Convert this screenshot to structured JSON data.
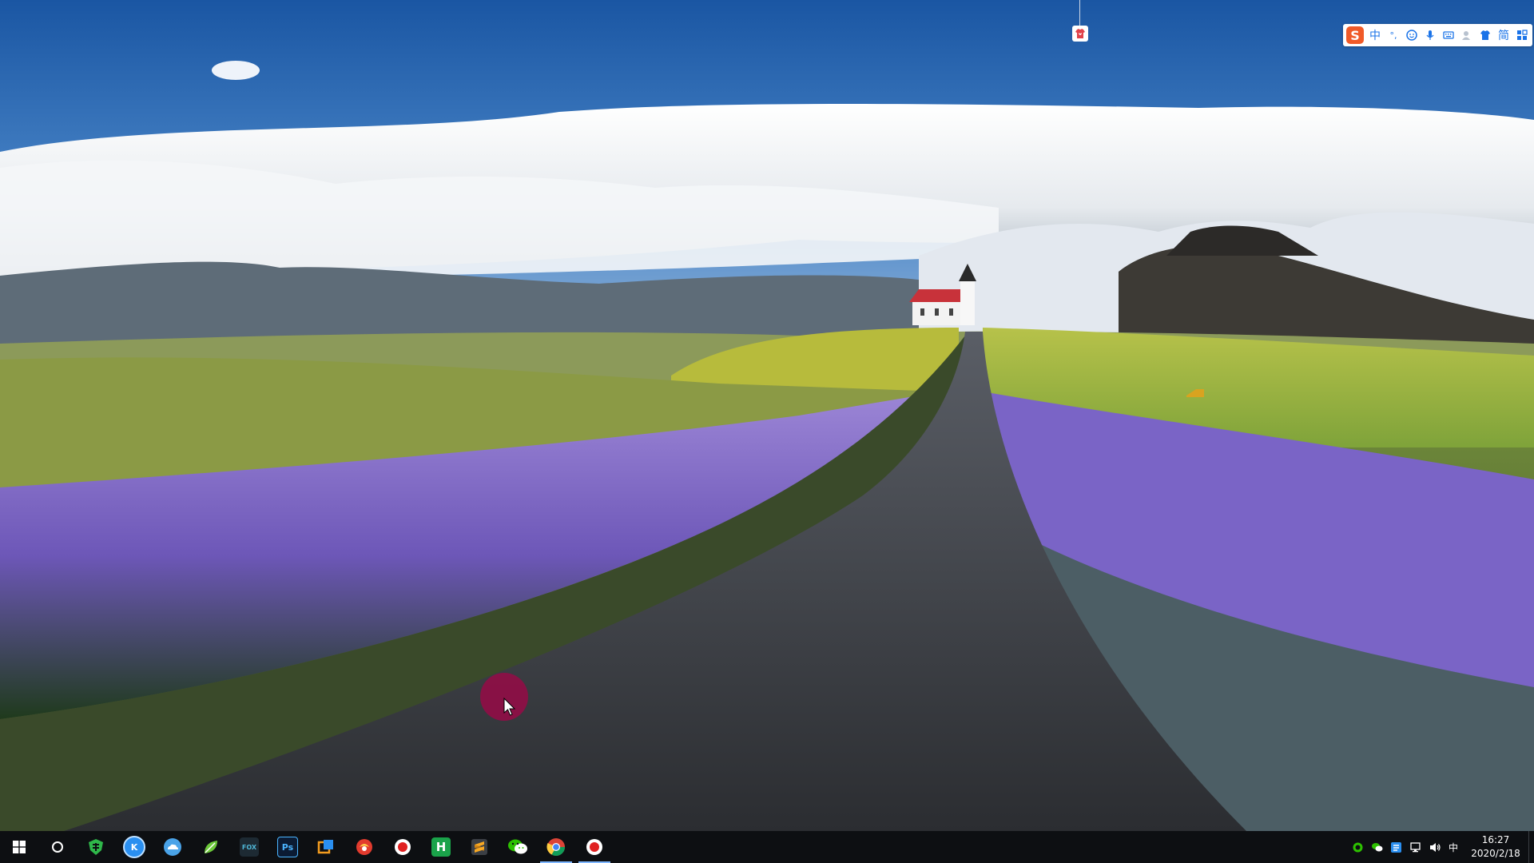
{
  "ime": {
    "icon": "sogou-logo",
    "mode_label": "中",
    "punctuation_label": "°,",
    "simplified_label": "简",
    "buttons": [
      "emoji-icon",
      "microphone-icon",
      "keyboard-icon",
      "user-icon",
      "skin-icon",
      "toolbox-icon"
    ]
  },
  "taskbar": {
    "apps": [
      {
        "name": "start",
        "icon": "windows-logo-icon"
      },
      {
        "name": "search",
        "icon": "cortana-circle-icon"
      },
      {
        "name": "app-green-shield",
        "icon": "green-shield-icon"
      },
      {
        "name": "app-kugou",
        "icon": "k-circle-icon",
        "label": "K"
      },
      {
        "name": "app-cloud",
        "icon": "cloud-icon"
      },
      {
        "name": "app-green-leaf",
        "icon": "leaf-icon"
      },
      {
        "name": "app-fox",
        "icon": "fox-icon",
        "label": "FOX"
      },
      {
        "name": "app-photoshop",
        "icon": "photoshop-icon",
        "label": "Ps"
      },
      {
        "name": "app-orange-window",
        "icon": "orange-window-icon"
      },
      {
        "name": "app-red-swirl",
        "icon": "red-swirl-icon"
      },
      {
        "name": "app-record",
        "icon": "record-icon"
      },
      {
        "name": "app-h",
        "icon": "h-icon",
        "label": "H"
      },
      {
        "name": "app-sublime",
        "icon": "sublime-icon"
      },
      {
        "name": "app-wechat",
        "icon": "wechat-icon"
      },
      {
        "name": "app-chrome",
        "icon": "chrome-icon"
      },
      {
        "name": "app-recorder",
        "icon": "screen-recorder-icon"
      }
    ],
    "tray": {
      "ime_label": "中",
      "time": "16:27",
      "date": "2020/2/18"
    }
  },
  "colors": {
    "taskbar_bg": "#0d0f12",
    "click_ring": "#960a46",
    "sogou_orange": "#f05a28"
  }
}
